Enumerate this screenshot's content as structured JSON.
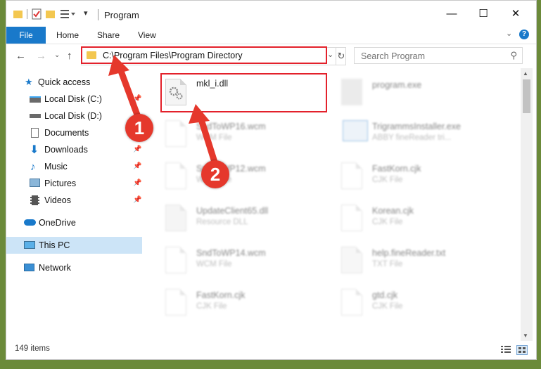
{
  "window": {
    "title": "Program",
    "controls": {
      "minimize": "—",
      "maximize": "☐",
      "close": "✕"
    }
  },
  "ribbon": {
    "tabs": [
      "File",
      "Home",
      "Share",
      "View"
    ],
    "help": "?"
  },
  "nav": {
    "address": "C:\\Program Files\\Program Directory",
    "search_placeholder": "Search Program"
  },
  "sidebar": {
    "items": [
      {
        "label": "Quick access",
        "icon": "star-icon",
        "pinned": false
      },
      {
        "label": "Local Disk (C:)",
        "icon": "drive-icon",
        "pinned": true
      },
      {
        "label": "Local Disk (D:)",
        "icon": "drive-icon",
        "pinned": false
      },
      {
        "label": "Documents",
        "icon": "document-icon",
        "pinned": true
      },
      {
        "label": "Downloads",
        "icon": "download-icon",
        "pinned": true
      },
      {
        "label": "Music",
        "icon": "music-icon",
        "pinned": true
      },
      {
        "label": "Pictures",
        "icon": "pictures-icon",
        "pinned": true
      },
      {
        "label": "Videos",
        "icon": "video-icon",
        "pinned": true
      },
      {
        "label": "OneDrive",
        "icon": "cloud-icon",
        "pinned": false
      },
      {
        "label": "This PC",
        "icon": "computer-icon",
        "pinned": false,
        "selected": true
      },
      {
        "label": "Network",
        "icon": "network-icon",
        "pinned": false
      }
    ]
  },
  "files": [
    {
      "name": "mkl_i.dll",
      "type": "",
      "highlighted": true
    },
    {
      "name": "program.exe",
      "type": ""
    },
    {
      "name": "SndToWP16.wcm",
      "type": "WCM File"
    },
    {
      "name": "TrigrammsInstaller.exe",
      "type": "ABBY fineReader tri..."
    },
    {
      "name": "SndToWP12.wcm",
      "type": "WCM File"
    },
    {
      "name": "FastKorn.cjk",
      "type": "CJK File"
    },
    {
      "name": "UpdateClient65.dll",
      "type": "Resource DLL"
    },
    {
      "name": "Korean.cjk",
      "type": "CJK File"
    },
    {
      "name": "SndToWP14.wcm",
      "type": "WCM File"
    },
    {
      "name": "help.fineReader.txt",
      "type": "TXT File"
    },
    {
      "name": "FastKorn.cjk",
      "type": "CJK File"
    },
    {
      "name": "gtd.cjk",
      "type": "CJK File"
    }
  ],
  "status": {
    "count": "149 items"
  },
  "annotations": {
    "step1": "1",
    "step2": "2"
  },
  "colors": {
    "accent": "#1979ca",
    "highlight": "#e3212b",
    "badge": "#e5382c"
  }
}
